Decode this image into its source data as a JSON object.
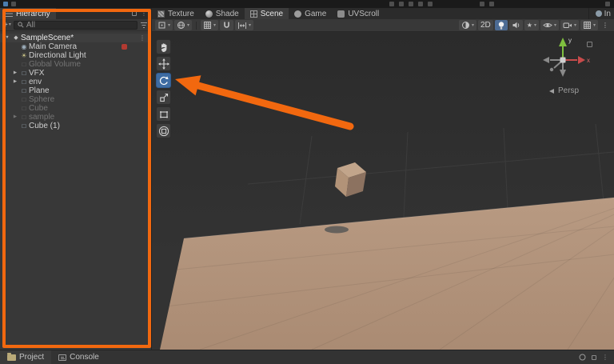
{
  "colors": {
    "annotation": "#f2680f",
    "tool_active": "#3e6ca3",
    "ground_plane": "#b2937c"
  },
  "glyphs": {
    "menu_dots": "⋮",
    "caret": "▾",
    "fold_open": "▼",
    "fold_closed": "▶",
    "plus": "+",
    "scene_icon": "◆",
    "gameobject_icon": "□",
    "camera_icon": "◉",
    "light_icon": "☀",
    "star": "★"
  },
  "hierarchy": {
    "tab": "Hierarchy",
    "search_value": "All",
    "items": [
      {
        "label": "SampleScene*"
      },
      {
        "label": "Main Camera"
      },
      {
        "label": "Directional Light"
      },
      {
        "label": "Global Volume"
      },
      {
        "label": "VFX"
      },
      {
        "label": "env"
      },
      {
        "label": "Plane"
      },
      {
        "label": "Sphere"
      },
      {
        "label": "Cube"
      },
      {
        "label": "sample"
      },
      {
        "label": "Cube (1)"
      }
    ]
  },
  "scene_panel": {
    "tabs": [
      "Texture",
      "Shade",
      "Scene",
      "Game",
      "UVScroll"
    ],
    "active_tab": "Scene",
    "toolbar": {
      "mode_2d": "2D"
    },
    "viewport": {
      "projection": "Persp",
      "axis_x": "x",
      "axis_y": "y"
    }
  },
  "inspector": {
    "tab_partial": "In"
  },
  "bottom_bar": {
    "tabs": [
      "Project",
      "Console"
    ]
  }
}
